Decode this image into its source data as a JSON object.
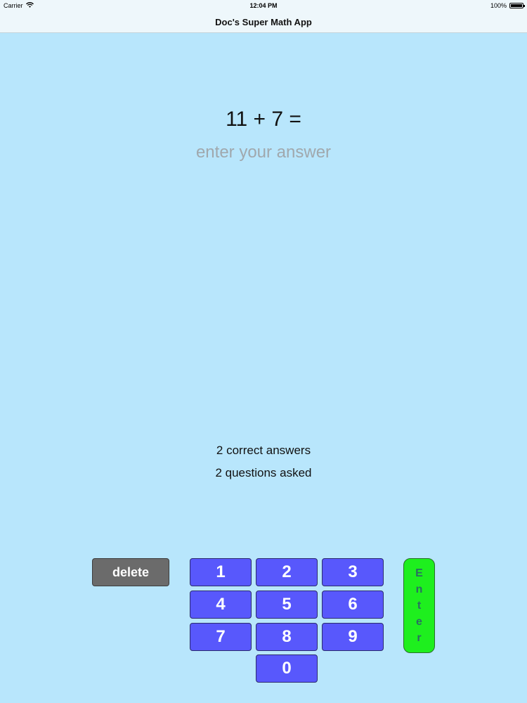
{
  "status_bar": {
    "carrier": "Carrier",
    "time": "12:04 PM",
    "battery": "100%",
    "battery_level": 1.0
  },
  "nav": {
    "title": "Doc's Super Math App"
  },
  "question": {
    "text": "11 + 7 =",
    "answer_value": "",
    "answer_placeholder": "enter your answer"
  },
  "stats": {
    "correct": "2 correct answers",
    "asked": "2 questions asked"
  },
  "keypad": {
    "delete_label": "delete",
    "keys": {
      "k1": "1",
      "k2": "2",
      "k3": "3",
      "k4": "4",
      "k5": "5",
      "k6": "6",
      "k7": "7",
      "k8": "8",
      "k9": "9",
      "k0": "0"
    },
    "enter_letters": [
      "E",
      "n",
      "t",
      "e",
      "r"
    ]
  },
  "colors": {
    "background": "#b8e6fc",
    "key_blue": "#5858fc",
    "delete_gray": "#6b6b6b",
    "enter_green": "#1eef1e"
  }
}
